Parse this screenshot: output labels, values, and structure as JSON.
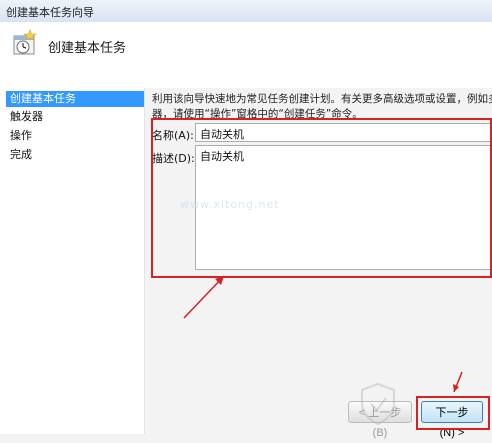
{
  "window": {
    "title": "创建基本任务向导"
  },
  "header": {
    "icon": "task-scheduler-clock-icon",
    "title": "创建基本任务"
  },
  "sidebar": {
    "items": [
      {
        "label": "创建基本任务",
        "active": true
      },
      {
        "label": "触发器",
        "active": false
      },
      {
        "label": "操作",
        "active": false
      },
      {
        "label": "完成",
        "active": false
      }
    ]
  },
  "main": {
    "description_line1": "利用该向导快速地为常见任务创建计划。有关更多高级选项或设置，例如多任务操",
    "description_line2": "器，请使用“操作”窗格中的“创建任务”命令。",
    "name_label": "名称(A):",
    "name_value": "自动关机",
    "desc_label": "描述(D):",
    "desc_value": "自动关机"
  },
  "watermark": "www.xitong.net",
  "buttons": {
    "back": "< 上一步(B)",
    "next": "下一步(N) >"
  },
  "annotation_color": "#d62222",
  "accent_color": "#3399ff"
}
